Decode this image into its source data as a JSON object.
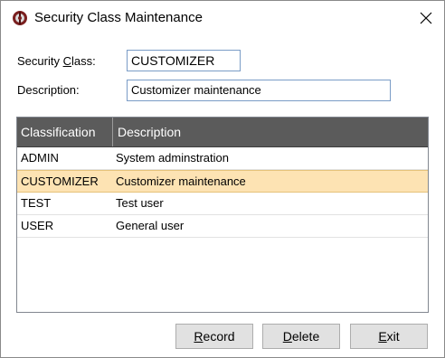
{
  "window": {
    "title": "Security Class Maintenance",
    "icon": "app-logo-icon",
    "close_icon": "close-icon"
  },
  "form": {
    "class_label_pre": "Security ",
    "class_label_u": "C",
    "class_label_post": "lass:",
    "class_value": "CUSTOMIZER",
    "desc_label": "Description:",
    "desc_value": "Customizer maintenance"
  },
  "grid": {
    "columns": [
      "Classification",
      "Description"
    ],
    "rows": [
      {
        "classification": "ADMIN",
        "description": "System adminstration"
      },
      {
        "classification": "CUSTOMIZER",
        "description": "Customizer maintenance",
        "selected": true
      },
      {
        "classification": "TEST",
        "description": "Test user"
      },
      {
        "classification": "USER",
        "description": "General user"
      }
    ]
  },
  "buttons": {
    "record_u": "R",
    "record_rest": "ecord",
    "delete_u": "D",
    "delete_rest": "elete",
    "exit_u": "E",
    "exit_rest": "xit"
  },
  "colors": {
    "header_bg": "#5b5b5b",
    "selected_row_bg": "#fde3b3"
  }
}
